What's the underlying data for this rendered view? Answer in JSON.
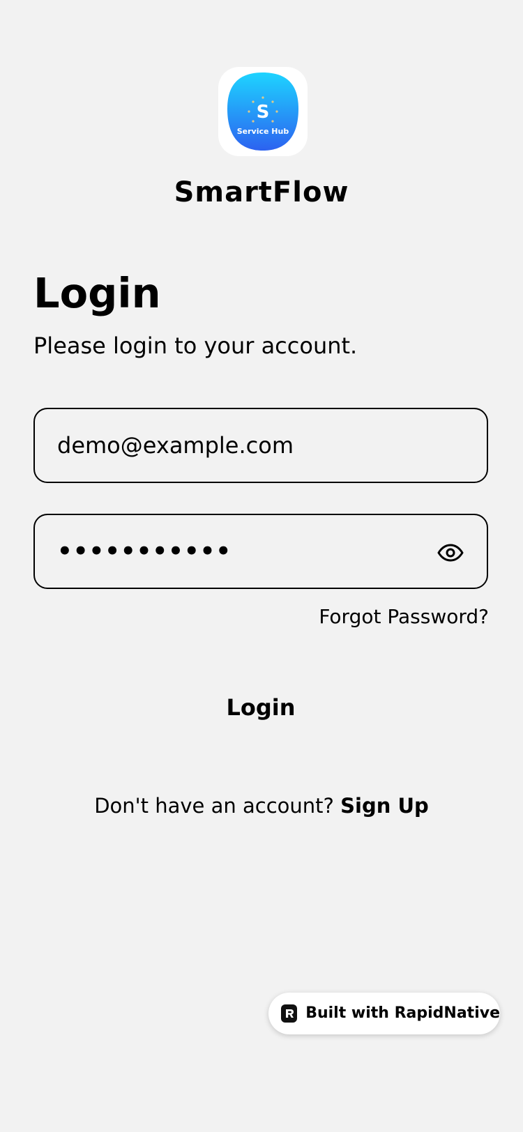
{
  "app": {
    "logo_word": "S",
    "logo_caption": "Service Hub",
    "name": "SmartFlow"
  },
  "login": {
    "title": "Login",
    "subtitle": "Please login to your account.",
    "email_value": "demo@example.com",
    "password_masked": "•••••••••••",
    "forgot_label": "Forgot Password?",
    "submit_label": "Login",
    "signup_prompt": "Don't have an account?",
    "signup_label": "Sign Up"
  },
  "badge": {
    "label": "Built with RapidNative"
  },
  "colors": {
    "background": "#f2f2f2",
    "logo_gradient_top": "#1ed4ff",
    "logo_gradient_bottom": "#2c62f0",
    "text": "#000000"
  },
  "icons": {
    "password_toggle": "eye-icon",
    "badge": "rapidnative-logo-icon"
  }
}
